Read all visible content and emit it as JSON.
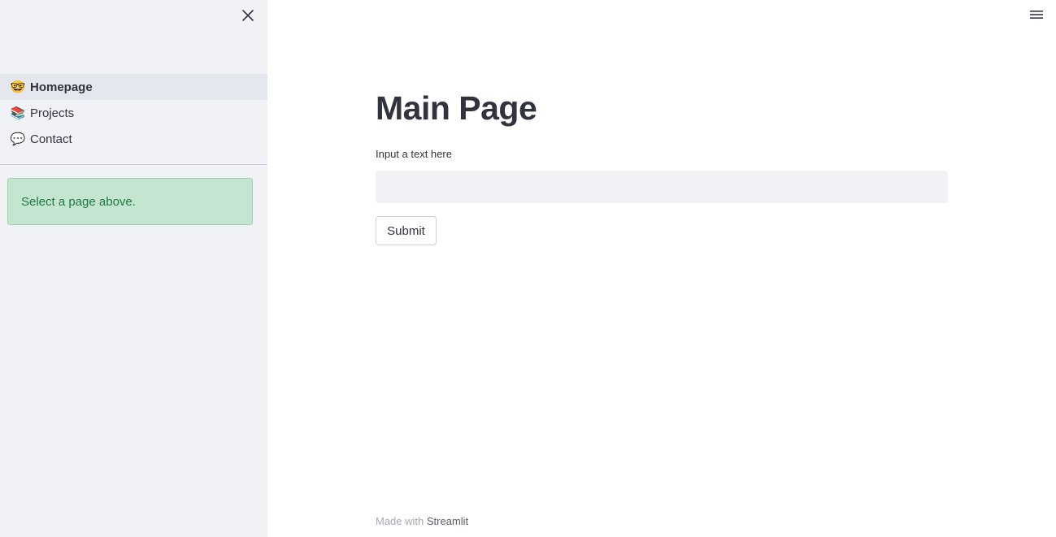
{
  "sidebar": {
    "close_icon": "close-icon",
    "nav": [
      {
        "emoji": "🤓",
        "icon": "nerd-face-icon",
        "label": "Homepage",
        "active": true
      },
      {
        "emoji": "📚",
        "icon": "books-icon",
        "label": "Projects",
        "active": false
      },
      {
        "emoji": "💬",
        "icon": "speech-bubble-icon",
        "label": "Contact",
        "active": false
      }
    ],
    "info": "Select a page above."
  },
  "header": {
    "menu_icon": "hamburger-menu-icon"
  },
  "main": {
    "title": "Main Page",
    "input_label": "Input a text here",
    "input_value": "",
    "submit_label": "Submit"
  },
  "footer": {
    "made_with": "Made with",
    "link": "Streamlit"
  },
  "colors": {
    "sidebar_bg": "#f0f2f6",
    "info_bg": "#c4e5d0",
    "info_text": "#1c7a3f",
    "text": "#31333f"
  }
}
